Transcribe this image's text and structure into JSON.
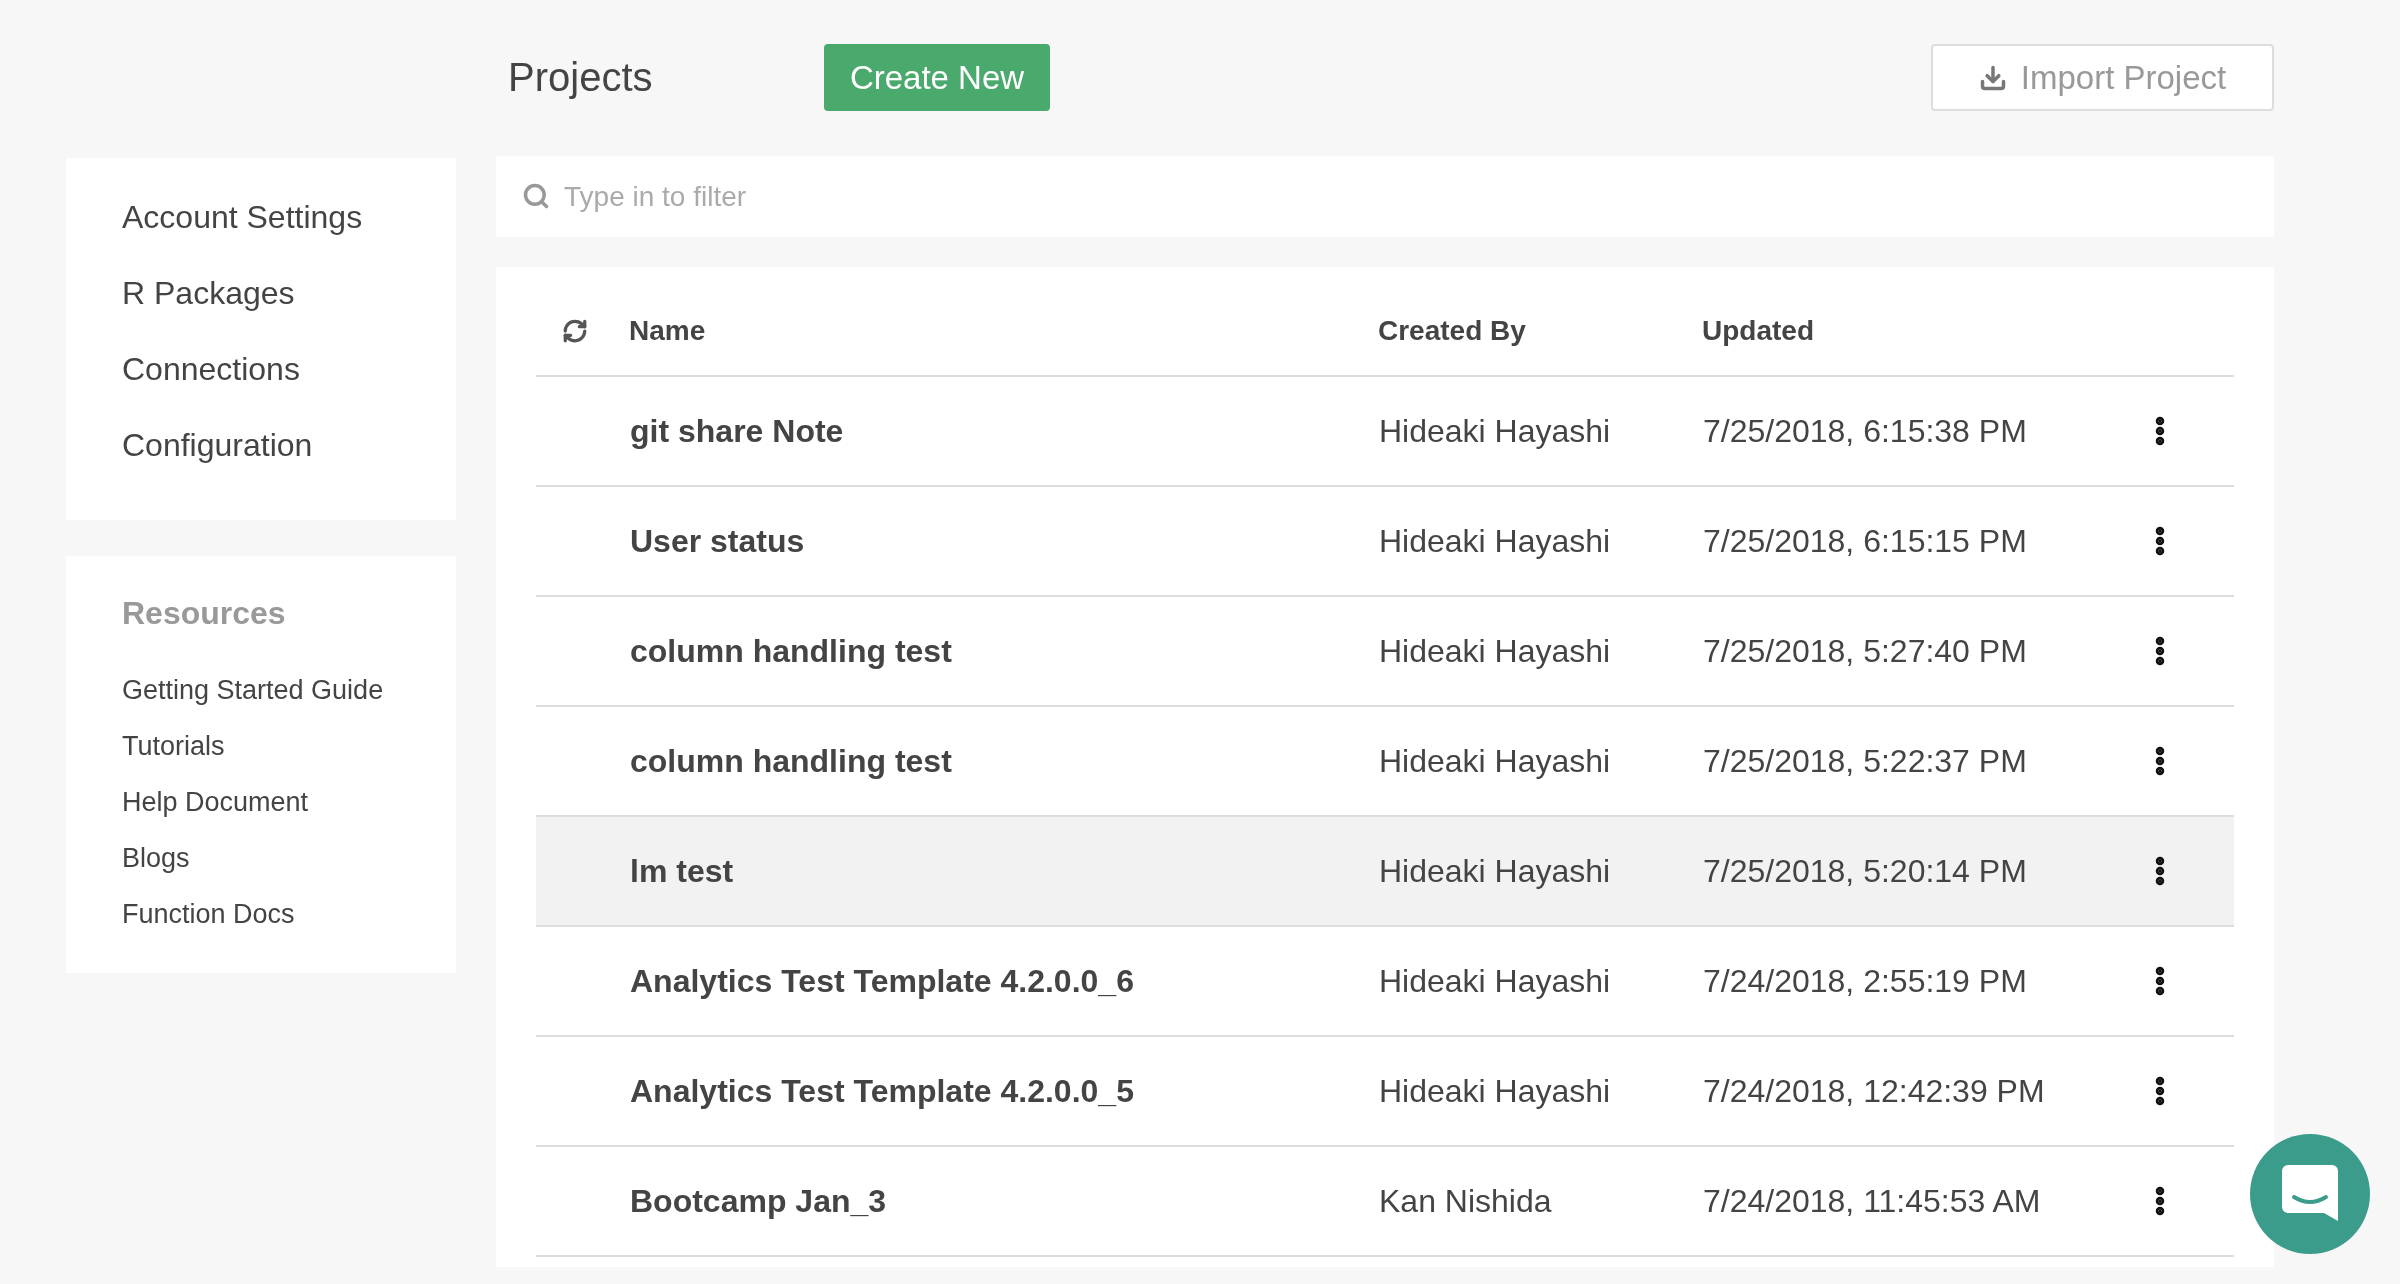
{
  "header": {
    "title": "Projects",
    "create_button": "Create New",
    "import_button": "Import Project"
  },
  "sidebar": {
    "items": [
      "Account Settings",
      "R Packages",
      "Connections",
      "Configuration"
    ],
    "resources_title": "Resources",
    "resources": [
      "Getting Started Guide",
      "Tutorials",
      "Help Document",
      "Blogs",
      "Function Docs"
    ]
  },
  "filter": {
    "placeholder": "Type in to filter"
  },
  "table": {
    "columns": [
      "Name",
      "Created By",
      "Updated"
    ],
    "rows": [
      {
        "name": "git share Note",
        "created_by": "Hideaki Hayashi",
        "updated": "7/25/2018, 6:15:38 PM",
        "selected": false
      },
      {
        "name": "User status",
        "created_by": "Hideaki Hayashi",
        "updated": "7/25/2018, 6:15:15 PM",
        "selected": false
      },
      {
        "name": "column handling test",
        "created_by": "Hideaki Hayashi",
        "updated": "7/25/2018, 5:27:40 PM",
        "selected": false
      },
      {
        "name": "column handling test",
        "created_by": "Hideaki Hayashi",
        "updated": "7/25/2018, 5:22:37 PM",
        "selected": false
      },
      {
        "name": "lm test",
        "created_by": "Hideaki Hayashi",
        "updated": "7/25/2018, 5:20:14 PM",
        "selected": true
      },
      {
        "name": "Analytics Test Template 4.2.0.0_6",
        "created_by": "Hideaki Hayashi",
        "updated": "7/24/2018, 2:55:19 PM",
        "selected": false
      },
      {
        "name": "Analytics Test Template 4.2.0.0_5",
        "created_by": "Hideaki Hayashi",
        "updated": "7/24/2018, 12:42:39 PM",
        "selected": false
      },
      {
        "name": "Bootcamp Jan_3",
        "created_by": "Kan Nishida",
        "updated": "7/24/2018, 11:45:53 AM",
        "selected": false
      }
    ]
  }
}
